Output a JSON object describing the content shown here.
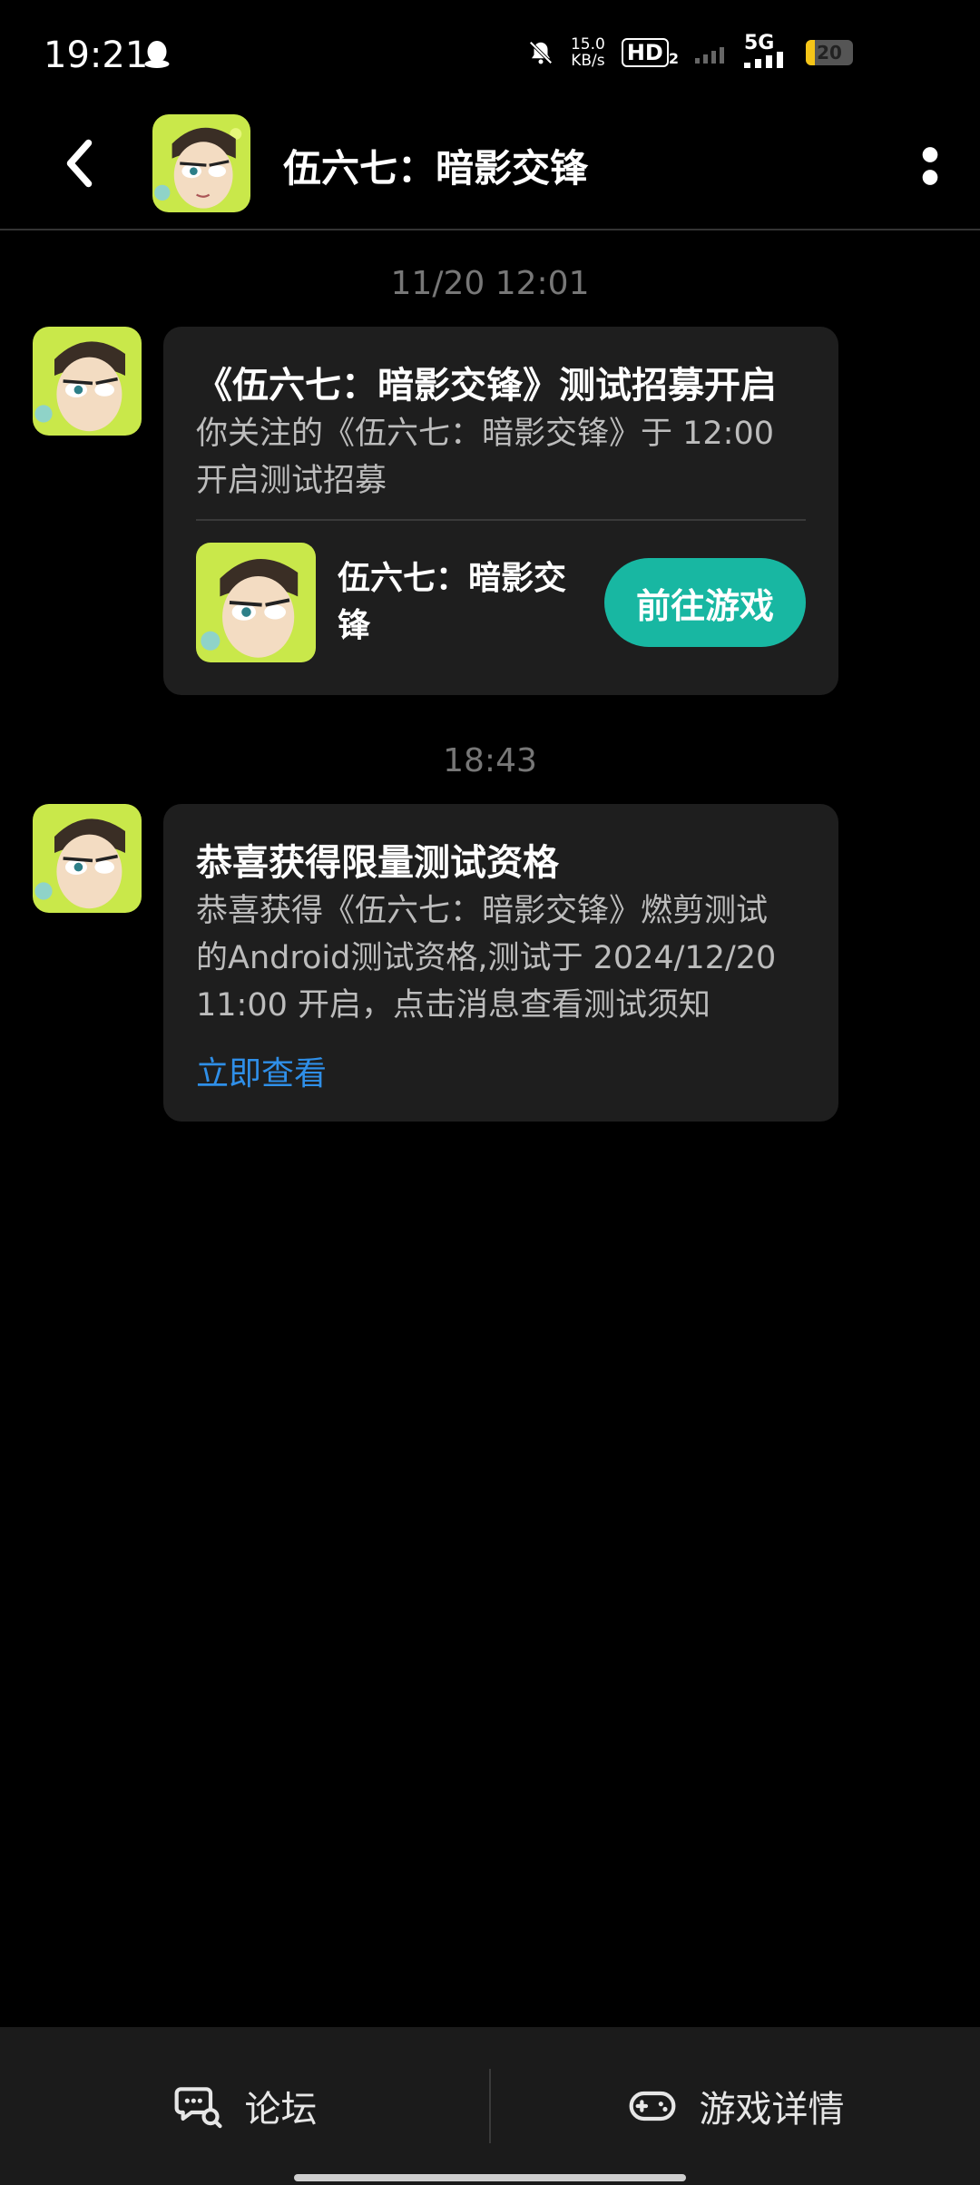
{
  "status_bar": {
    "time": "19:21",
    "speed_value": "15.0",
    "speed_unit": "KB/s",
    "hd_label": "HD",
    "hd_sub": "2",
    "signal_label": "5G",
    "battery": "20"
  },
  "header": {
    "title": "伍六七：暗影交锋"
  },
  "messages": [
    {
      "timestamp": "11/20  12:01",
      "title": "《伍六七：暗影交锋》测试招募开启",
      "body_line1": "你关注的《伍六七：暗影交锋》于 12:00",
      "body_line2": "开启测试招募",
      "game_name_line1": "伍六七：暗影交",
      "game_name_line2": "锋",
      "button_label": "前往游戏"
    },
    {
      "timestamp": "18:43",
      "title": "恭喜获得限量测试资格",
      "body_line1": "恭喜获得《伍六七：暗影交锋》燃剪测试",
      "body_line2": "的Android测试资格,测试于 2024/12/20",
      "body_line3": "11:00 开启，点击消息查看测试须知",
      "link_label": "立即查看"
    }
  ],
  "bottom_tabs": [
    {
      "label": "论坛",
      "icon": "forum-icon"
    },
    {
      "label": "游戏详情",
      "icon": "gamepad-icon"
    }
  ],
  "colors": {
    "accent": "#18b7a2",
    "link": "#2f8fe8",
    "card_bg": "#1e1e1e"
  }
}
